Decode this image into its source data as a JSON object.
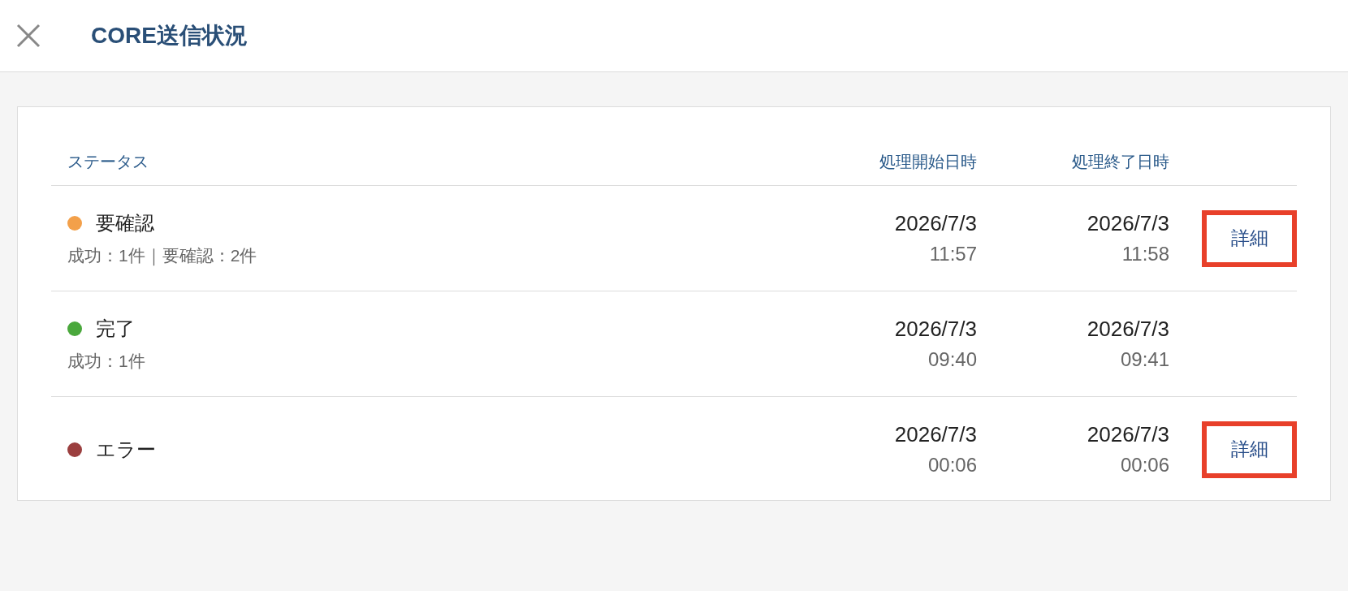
{
  "header": {
    "title": "CORE送信状況"
  },
  "table": {
    "columns": [
      "ステータス",
      "処理開始日時",
      "処理終了日時"
    ],
    "rows": [
      {
        "status": "要確認",
        "color": "#f3a04a",
        "summary": "成功：1件｜要確認：2件",
        "start_date": "2026/7/3",
        "start_time": "11:57",
        "end_date": "2026/7/3",
        "end_time": "11:58",
        "action": "詳細"
      },
      {
        "status": "完了",
        "color": "#4aa83c",
        "summary": "成功：1件",
        "start_date": "2026/7/3",
        "start_time": "09:40",
        "end_date": "2026/7/3",
        "end_time": "09:41"
      },
      {
        "status": "エラー",
        "color": "#9b3f3f",
        "start_date": "2026/7/3",
        "start_time": "00:06",
        "end_date": "2026/7/3",
        "end_time": "00:06",
        "action": "詳細"
      }
    ]
  }
}
